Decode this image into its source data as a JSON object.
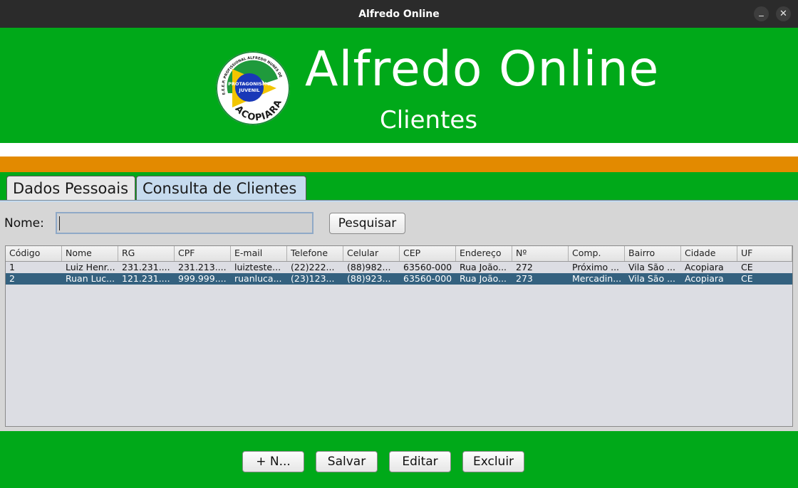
{
  "window": {
    "title": "Alfredo Online"
  },
  "header": {
    "title": "Alfredo Online",
    "subtitle": "Clientes",
    "logo": {
      "top_text": "E.E.E.P. PROFISSIONAL ALFREDO NUNES DE MELO",
      "center_text_1": "PROTAGONISMO",
      "center_text_2": "JUVENIL",
      "bottom_text": "ACOPIARA"
    }
  },
  "tabs": [
    {
      "label": "Dados Pessoais"
    },
    {
      "label": "Consulta de Clientes"
    }
  ],
  "search": {
    "label": "Nome:",
    "value": "",
    "button": "Pesquisar"
  },
  "table": {
    "columns": [
      "Código",
      "Nome",
      "RG",
      "CPF",
      "E-mail",
      "Telefone",
      "Celular",
      "CEP",
      "Endereço",
      "Nº",
      "Comp.",
      "Bairro",
      "Cidade",
      "UF"
    ],
    "rows": [
      [
        "1",
        "Luiz Henr...",
        "231.231....",
        "231.213....",
        "luizteste...",
        "(22)222...",
        "(88)982...",
        "63560-000",
        "Rua João...",
        "272",
        "Próximo ...",
        "Vila São ...",
        "Acopiara",
        "CE"
      ],
      [
        "2",
        "Ruan Luc...",
        "121.231....",
        "999.999....",
        "ruanluca...",
        "(23)123...",
        "(88)923...",
        "63560-000",
        "Rua João...",
        "273",
        "Mercadin...",
        "Vila São ...",
        "Acopiara",
        "CE"
      ]
    ],
    "selected_row": 2
  },
  "actions": {
    "new": "+ N...",
    "save": "Salvar",
    "edit": "Editar",
    "delete": "Excluir"
  },
  "colors": {
    "green": "#00a919",
    "orange": "#e38a00",
    "selection": "#34617f",
    "tab_active": "#c6dbee"
  },
  "icons": {
    "minimize": "minimize-icon",
    "close": "close-icon"
  }
}
